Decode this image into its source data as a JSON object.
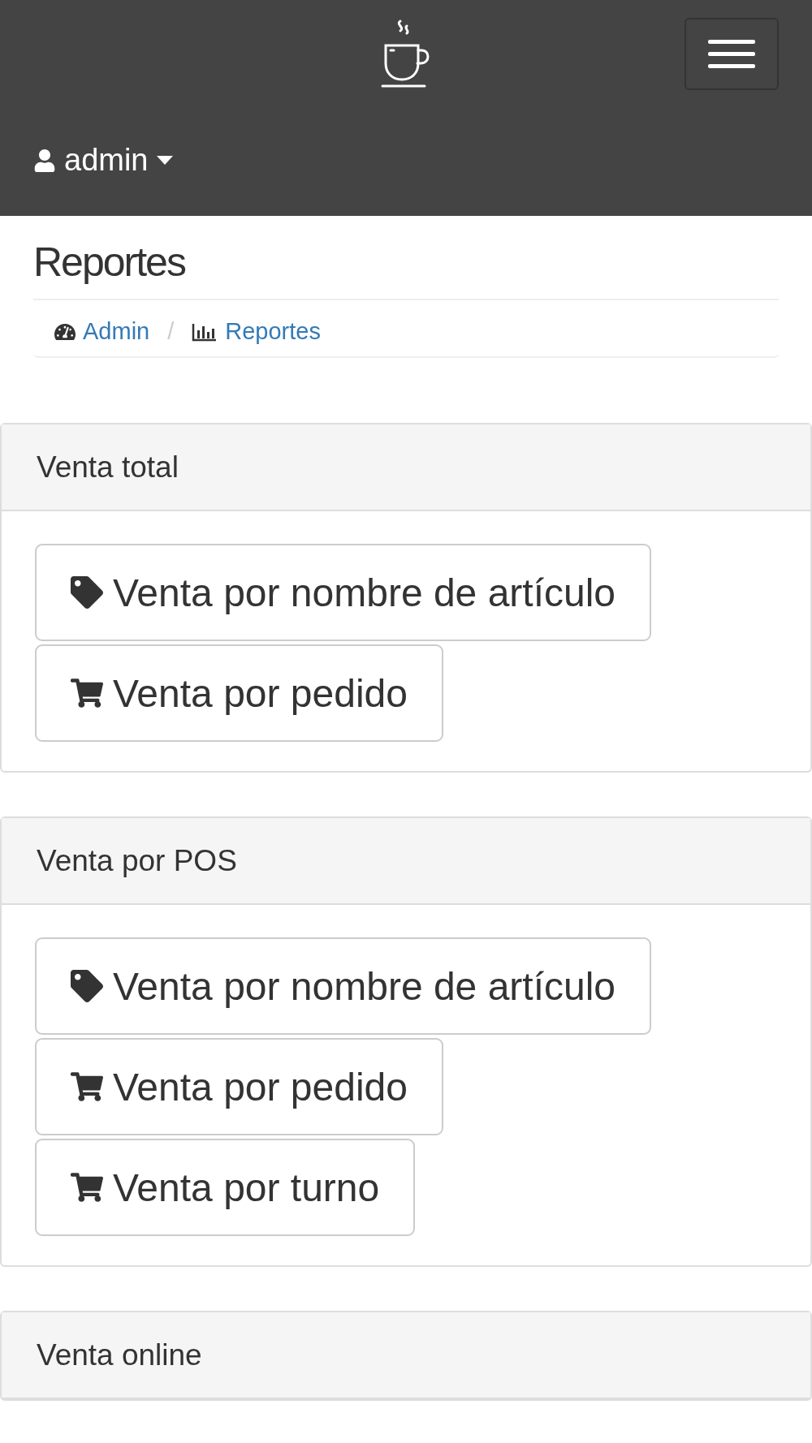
{
  "navbar": {
    "user": "admin"
  },
  "page_title": "Reportes",
  "breadcrumb": {
    "separator": "/",
    "items": [
      {
        "label": "Admin",
        "kind": "dashboard"
      },
      {
        "label": "Reportes",
        "kind": "chart"
      }
    ]
  },
  "panels": [
    {
      "title": "Venta total",
      "buttons": [
        {
          "label": "Venta por nombre de artículo",
          "kind": "tag"
        },
        {
          "label": "Venta por pedido",
          "kind": "cart"
        }
      ]
    },
    {
      "title": "Venta por POS",
      "buttons": [
        {
          "label": "Venta por nombre de artículo",
          "kind": "tag"
        },
        {
          "label": "Venta por pedido",
          "kind": "cart"
        },
        {
          "label": "Venta por turno",
          "kind": "cart"
        }
      ]
    },
    {
      "title": "Venta online"
    }
  ]
}
